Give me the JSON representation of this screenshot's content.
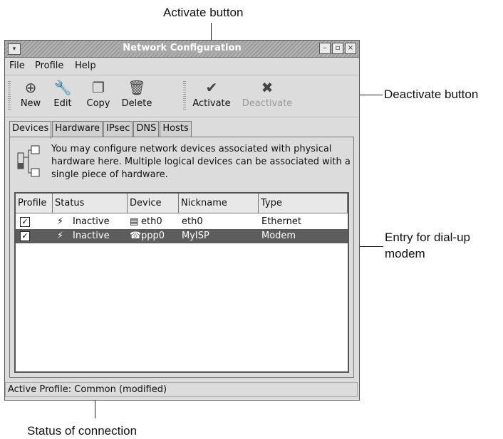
{
  "callouts": {
    "activate": "Activate button",
    "deactivate": "Deactivate button",
    "entry_line1": "Entry for dial-up",
    "entry_line2": "modem",
    "status": "Status of connection"
  },
  "window": {
    "title": "Network Configuration",
    "menu": [
      "File",
      "Profile",
      "Help"
    ],
    "toolbar": {
      "new": "New",
      "edit": "Edit",
      "copy": "Copy",
      "delete": "Delete",
      "activate": "Activate",
      "deactivate": "Deactivate"
    },
    "tabs": [
      "Devices",
      "Hardware",
      "IPsec",
      "DNS",
      "Hosts"
    ],
    "info": "You may configure network devices associated with physical hardware here.  Multiple logical devices can be associated with a single piece of hardware.",
    "columns": [
      "Profile",
      "Status",
      "Device",
      "Nickname",
      "Type"
    ],
    "rows": [
      {
        "profile": "✓",
        "status": "Inactive",
        "device": "eth0",
        "nickname": "eth0",
        "type": "Ethernet",
        "selected": false
      },
      {
        "profile": "✓",
        "status": "Inactive",
        "device": "ppp0",
        "nickname": "MyISP",
        "type": "Modem",
        "selected": true
      }
    ],
    "status_bar": "Active Profile: Common (modified)"
  }
}
